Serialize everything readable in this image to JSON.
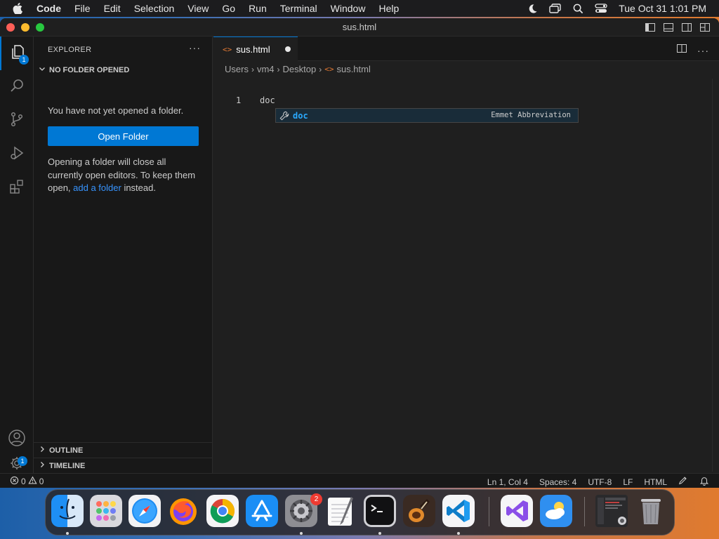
{
  "menubar": {
    "app": "Code",
    "items": [
      "File",
      "Edit",
      "Selection",
      "View",
      "Go",
      "Run",
      "Terminal",
      "Window",
      "Help"
    ],
    "clock": "Tue Oct 31  1:01 PM"
  },
  "window": {
    "title": "sus.html",
    "traffic_colors": {
      "close": "#ff5f57",
      "minimize": "#febc2e",
      "zoom": "#28c840"
    }
  },
  "activity": {
    "explorer_badge": "1",
    "manage_badge": "1"
  },
  "sidebar": {
    "title": "EXPLORER",
    "more": "···",
    "section": "NO FOLDER OPENED",
    "message": "You have not yet opened a folder.",
    "open_button": "Open Folder",
    "hint_before": "Opening a folder will close all currently open editors. To keep them open, ",
    "hint_link": "add a folder",
    "hint_after": " instead.",
    "outline": "OUTLINE",
    "timeline": "TIMELINE"
  },
  "editor": {
    "tab": {
      "icon": "<>",
      "label": "sus.html"
    },
    "breadcrumbs": [
      "Users",
      "vm4",
      "Desktop",
      "sus.html"
    ],
    "breadcrumb_file_icon": "<>",
    "line_number": "1",
    "line_text": "doc",
    "suggestion": {
      "label": "doc",
      "detail": "Emmet Abbreviation"
    }
  },
  "statusbar": {
    "errors": "0",
    "warnings": "0",
    "position": "Ln 1, Col 4",
    "spaces": "Spaces: 4",
    "encoding": "UTF-8",
    "eol": "LF",
    "language": "HTML"
  },
  "dock": {
    "settings_badge": "2"
  },
  "colors": {
    "accent": "#0078d4",
    "link": "#3794ff",
    "suggest_label": "#2aaaff",
    "html_icon": "#e37933"
  }
}
